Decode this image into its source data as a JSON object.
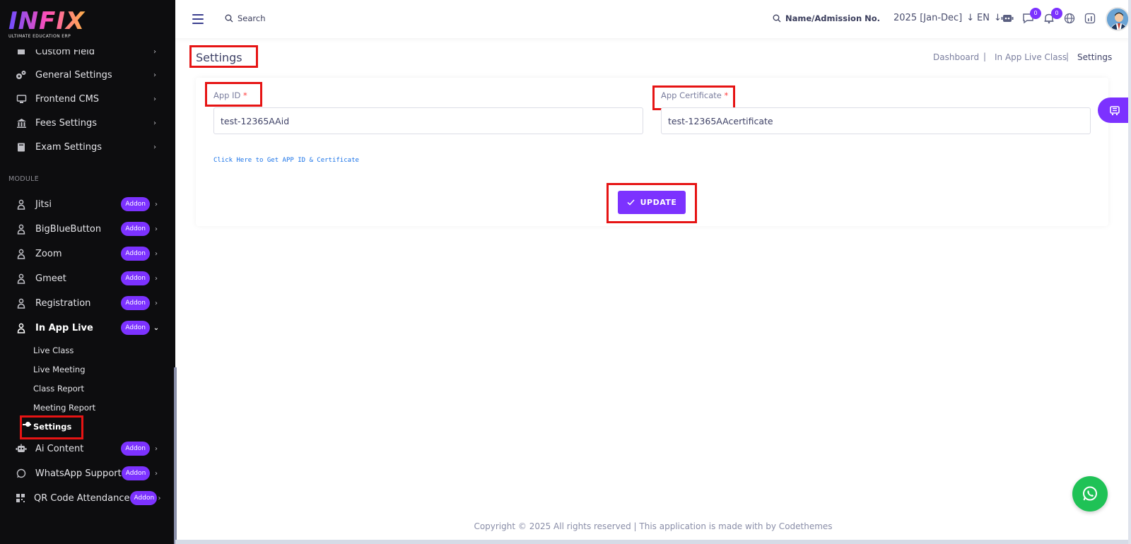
{
  "logo": {
    "text": "INFIX",
    "subtitle": "ULTIMATE EDUCATION ERP"
  },
  "sidebar": {
    "settings_items": [
      {
        "label": "Custom Field",
        "icon": "custom-field-icon"
      },
      {
        "label": "General Settings",
        "icon": "gears-icon"
      },
      {
        "label": "Frontend CMS",
        "icon": "monitor-icon"
      },
      {
        "label": "Fees Settings",
        "icon": "bank-icon"
      },
      {
        "label": "Exam Settings",
        "icon": "book-icon"
      }
    ],
    "module_label": "MODULE",
    "module_items": [
      {
        "label": "Jitsi",
        "badge": "Addon"
      },
      {
        "label": "BigBlueButton",
        "badge": "Addon"
      },
      {
        "label": "Zoom",
        "badge": "Addon"
      },
      {
        "label": "Gmeet",
        "badge": "Addon"
      },
      {
        "label": "Registration",
        "badge": "Addon"
      },
      {
        "label": "In App Live",
        "badge": "Addon"
      }
    ],
    "sub_items": [
      "Live Class",
      "Live Meeting",
      "Class Report",
      "Meeting Report",
      "Settings"
    ],
    "after_items": [
      {
        "label": "Ai Content",
        "badge": "Addon"
      },
      {
        "label": "WhatsApp Support",
        "badge": "Addon"
      },
      {
        "label": "QR Code Attendance",
        "badge": "Addon"
      }
    ]
  },
  "topbar": {
    "search_label": "Search",
    "student_search_label": "Name/Admission No.",
    "year": "2025 [Jan-Dec]",
    "language": "EN",
    "chat_count": "0",
    "notification_count": "0"
  },
  "page": {
    "title": "Settings",
    "breadcrumb": [
      "Dashboard",
      "In App Live Class",
      "Settings"
    ],
    "breadcrumb_sep": "|"
  },
  "form": {
    "app_id_label": "App ID",
    "app_id_value": "test-12365AAid",
    "app_cert_label": "App Certificate",
    "app_cert_value": "test-12365AAcertificate",
    "required_mark": "*",
    "link_text": "Click Here to Get APP ID & Certificate",
    "update_label": "UPDATE"
  },
  "footer": {
    "text": "Copyright © 2025 All rights reserved | This application is made with by Codethemes"
  },
  "colors": {
    "accent": "#7c32ff",
    "highlight": "#e61414",
    "sidebar_bg": "#0d0d0f",
    "whatsapp": "#1fc256"
  }
}
